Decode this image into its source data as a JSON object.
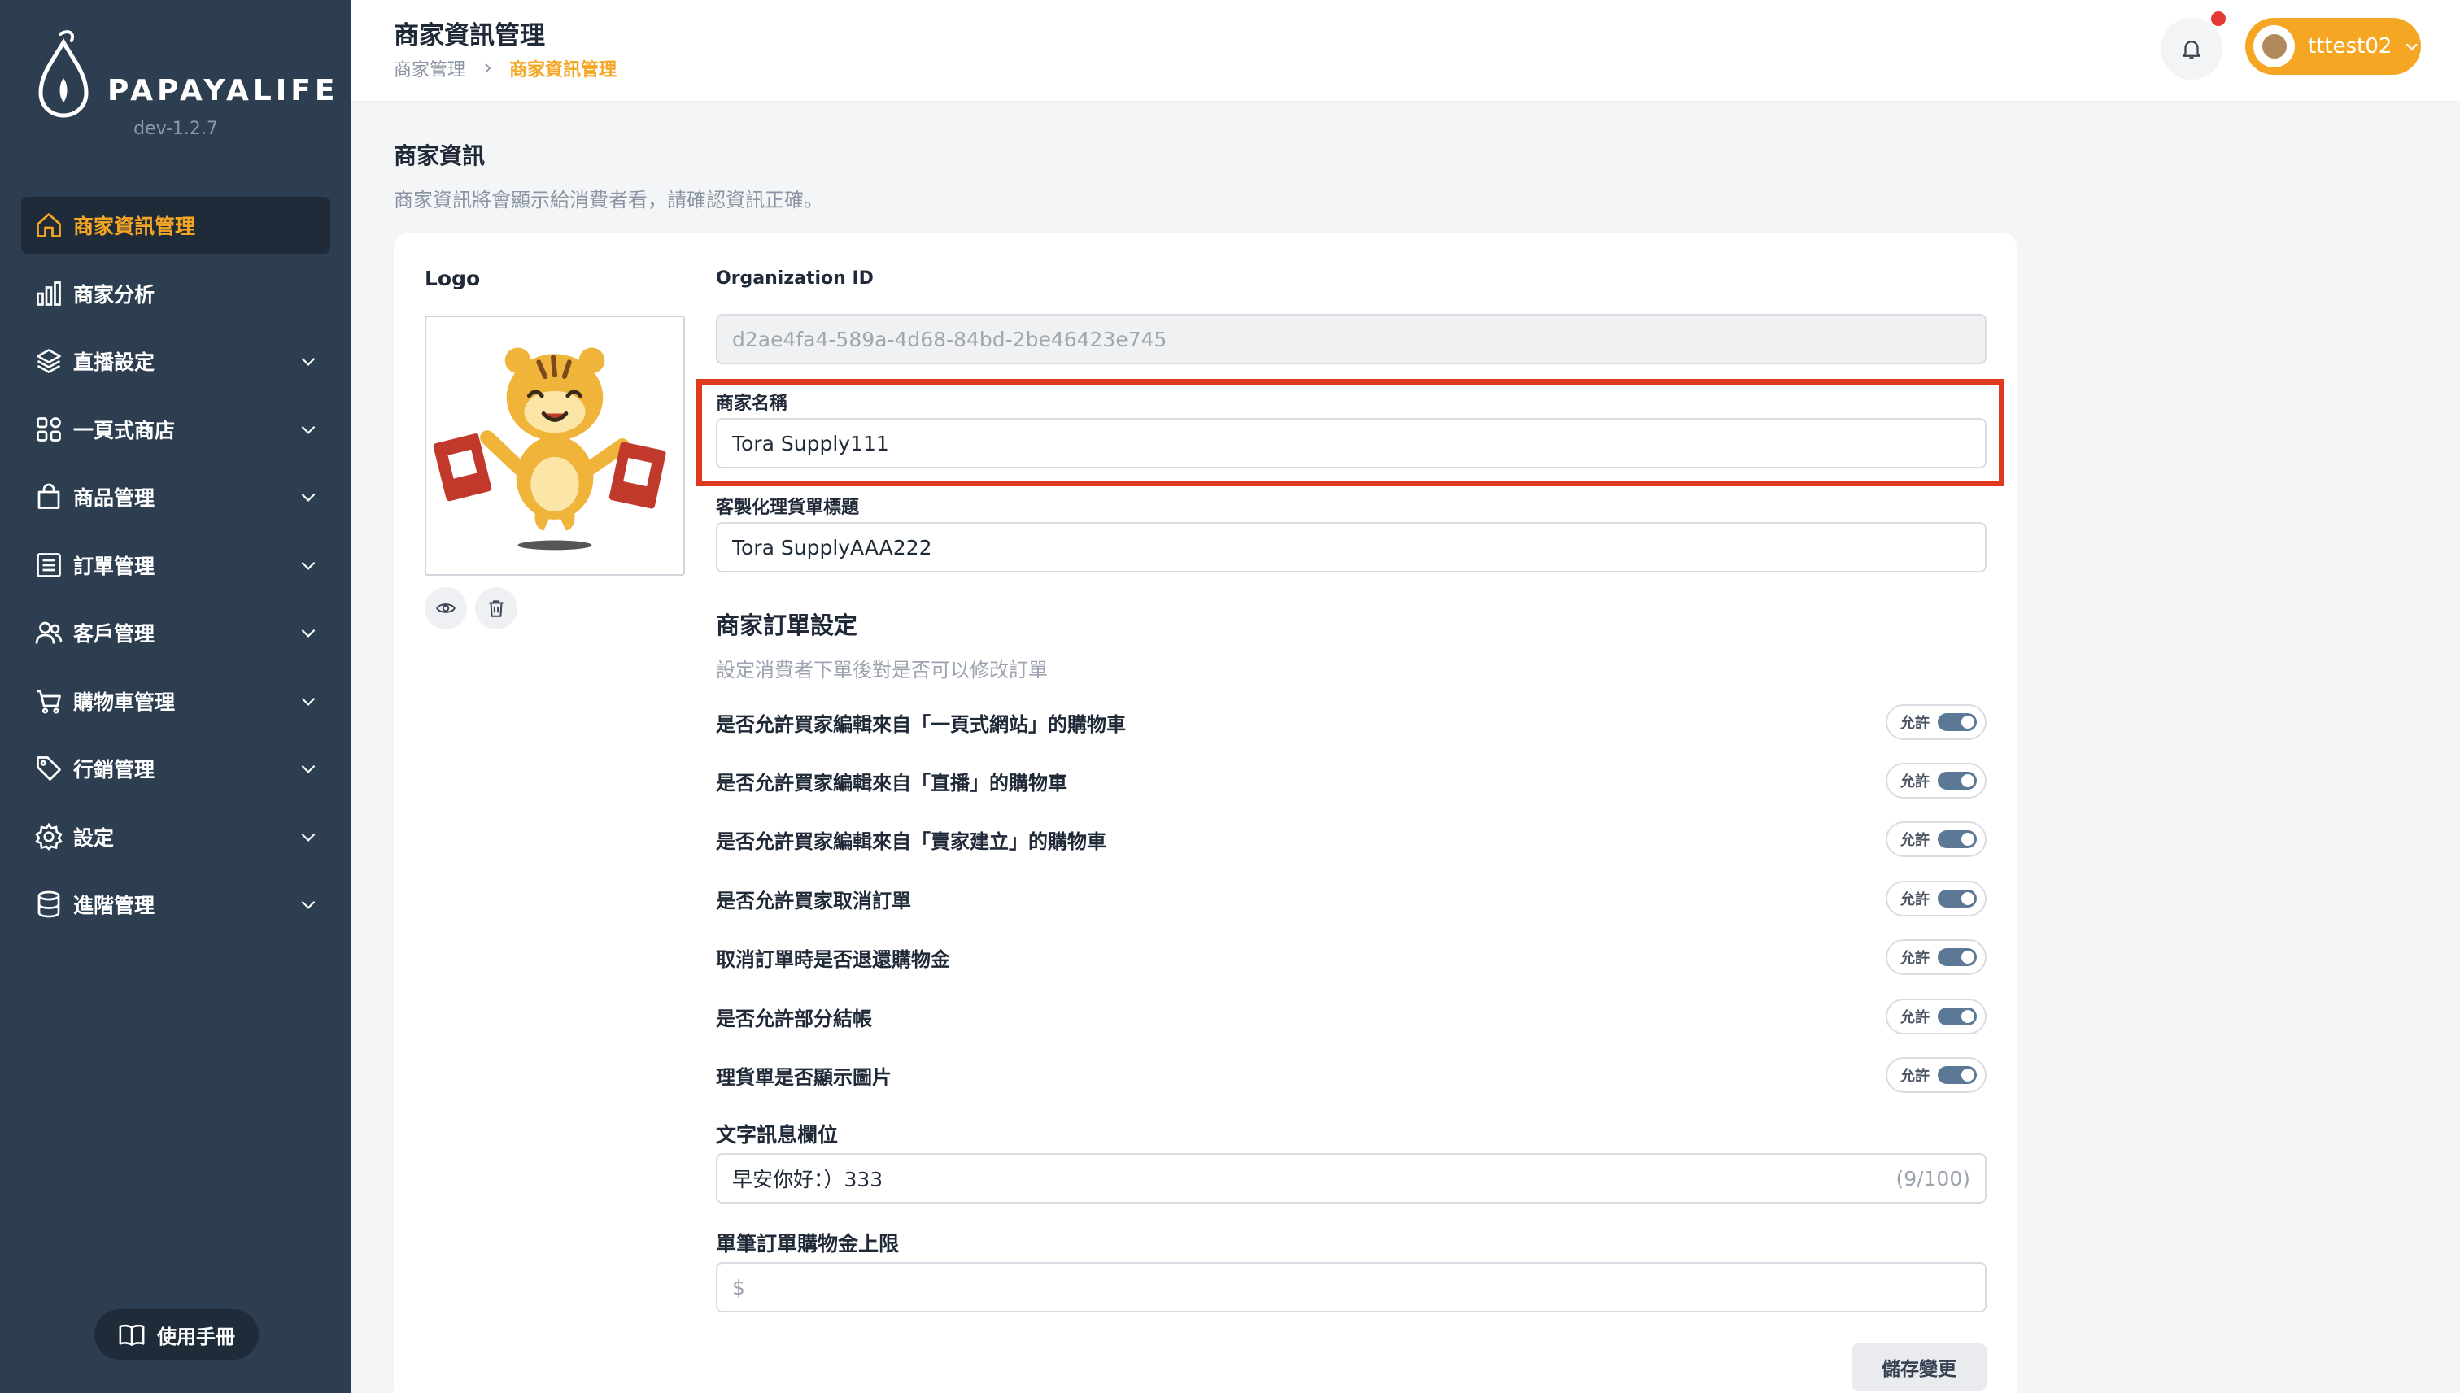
{
  "app": {
    "logo_text": "PAPAYALIFE",
    "version": "dev-1.2.7"
  },
  "sidebar": {
    "items": [
      {
        "label": "商家資訊管理",
        "icon": "home-icon",
        "active": true
      },
      {
        "label": "商家分析",
        "icon": "bar-chart-icon"
      },
      {
        "label": "直播設定",
        "icon": "layers-icon"
      },
      {
        "label": "一頁式商店",
        "icon": "grid-icon"
      },
      {
        "label": "商品管理",
        "icon": "shopping-bag-icon"
      },
      {
        "label": "訂單管理",
        "icon": "list-icon"
      },
      {
        "label": "客戶管理",
        "icon": "users-icon"
      },
      {
        "label": "購物車管理",
        "icon": "cart-icon"
      },
      {
        "label": "行銷管理",
        "icon": "tag-icon"
      },
      {
        "label": "設定",
        "icon": "gear-icon"
      },
      {
        "label": "進階管理",
        "icon": "database-icon"
      }
    ],
    "manual_label": "使用手冊"
  },
  "header": {
    "title": "商家資訊管理",
    "breadcrumb": [
      "商家管理",
      "商家資訊管理"
    ],
    "username": "tttest02"
  },
  "section": {
    "title": "商家資訊",
    "subtitle": "商家資訊將會顯示給消費者看，請確認資訊正確。"
  },
  "form": {
    "logo_label": "Logo",
    "org_id_label": "Organization ID",
    "org_id_value": "d2ae4fa4-589a-4d68-84bd-2be46423e745",
    "name_label": "商家名稱",
    "name_value": "Tora Supply111",
    "invoice_title_label": "客製化理貨單標題",
    "invoice_title_value": "Tora SupplyAAA222",
    "order_settings_title": "商家訂單設定",
    "order_settings_desc": "設定消費者下單後對是否可以修改訂單",
    "toggle_text": "允許",
    "toggles": [
      "是否允許買家編輯來自「一頁式網站」的購物車",
      "是否允許買家編輯來自「直播」的購物車",
      "是否允許買家編輯來自「賣家建立」的購物車",
      "是否允許買家取消訂單",
      "取消訂單時是否退還購物金",
      "是否允許部分結帳",
      "理貨單是否顯示圖片"
    ],
    "message_label": "文字訊息欄位",
    "message_value": "早安你好：）333",
    "message_counter": "(9/100)",
    "credit_limit_label": "單筆訂單購物金上限",
    "credit_prefix": "$",
    "save_label": "儲存變更"
  },
  "colors": {
    "sidebar_bg": "#2c3e50",
    "accent": "#f5a623",
    "highlight": "#e03a1e"
  }
}
